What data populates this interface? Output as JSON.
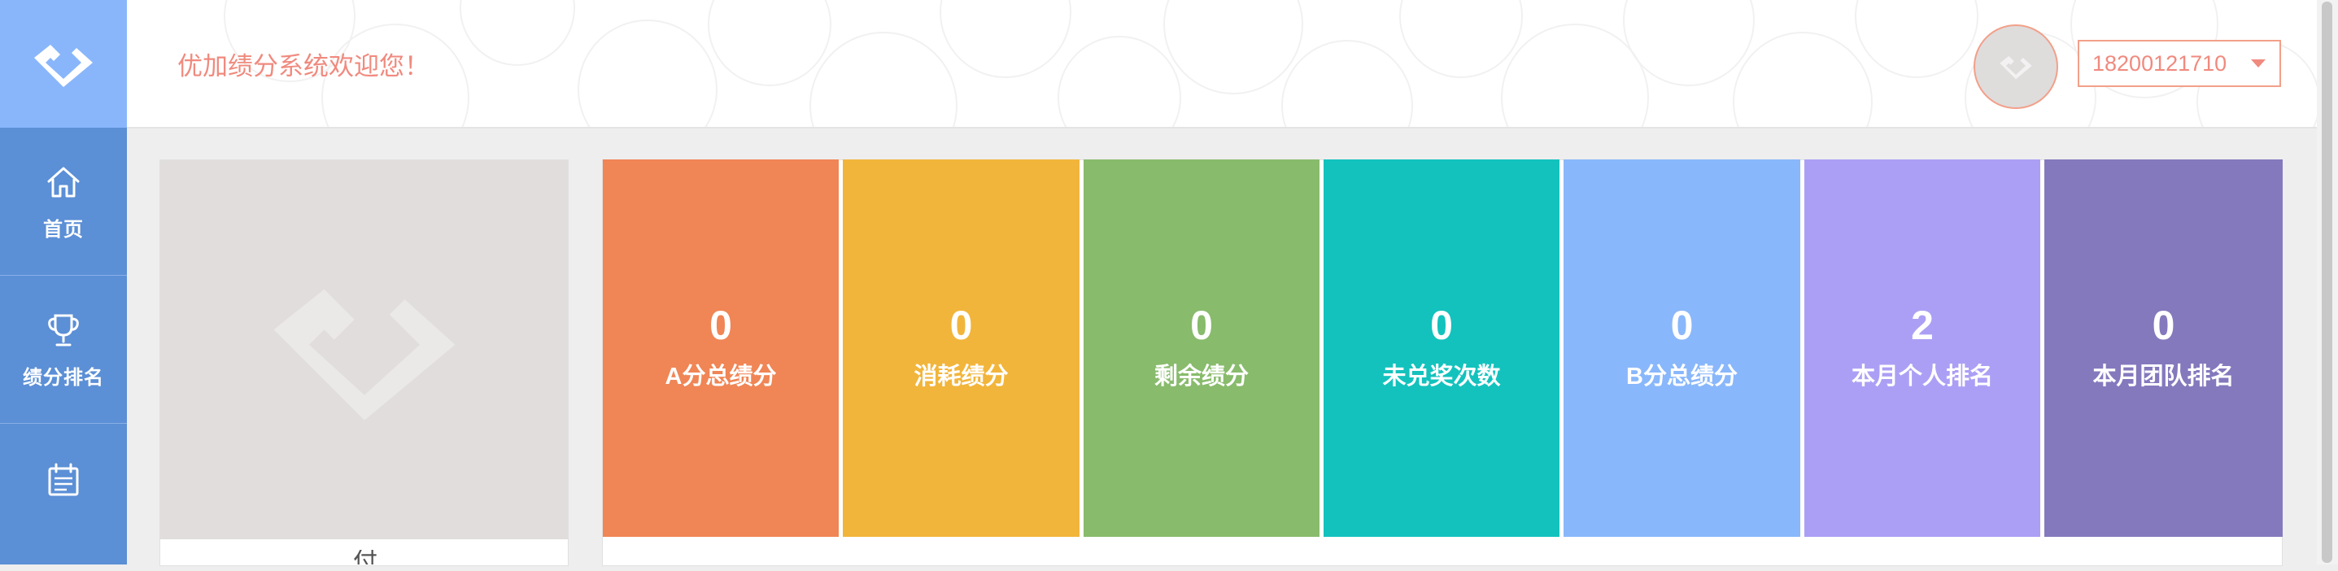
{
  "header": {
    "welcome": "优加绩分系统欢迎您！",
    "user_select": {
      "value": "18200121710"
    }
  },
  "sidebar": {
    "items": [
      {
        "label": "首页",
        "icon": "home-icon"
      },
      {
        "label": "绩分排名",
        "icon": "trophy-icon"
      },
      {
        "label": "",
        "icon": "calendar-icon"
      }
    ]
  },
  "profile": {
    "name_partial": "付"
  },
  "stats": [
    {
      "value": "0",
      "label": "A分总绩分",
      "color": "#f08555"
    },
    {
      "value": "0",
      "label": "消耗绩分",
      "color": "#f2b53b"
    },
    {
      "value": "0",
      "label": "剩余绩分",
      "color": "#88bb6c"
    },
    {
      "value": "0",
      "label": "未兑奖次数",
      "color": "#13c2bd"
    },
    {
      "value": "0",
      "label": "B分总绩分",
      "color": "#89b7fb"
    },
    {
      "value": "2",
      "label": "本月个人排名",
      "color": "#ab9ff5"
    },
    {
      "value": "0",
      "label": "本月团队排名",
      "color": "#8479bd"
    }
  ],
  "colors": {
    "sidebar": "#5b8fd6",
    "logo_box": "#89b6fb",
    "accent": "#f08a7e"
  }
}
